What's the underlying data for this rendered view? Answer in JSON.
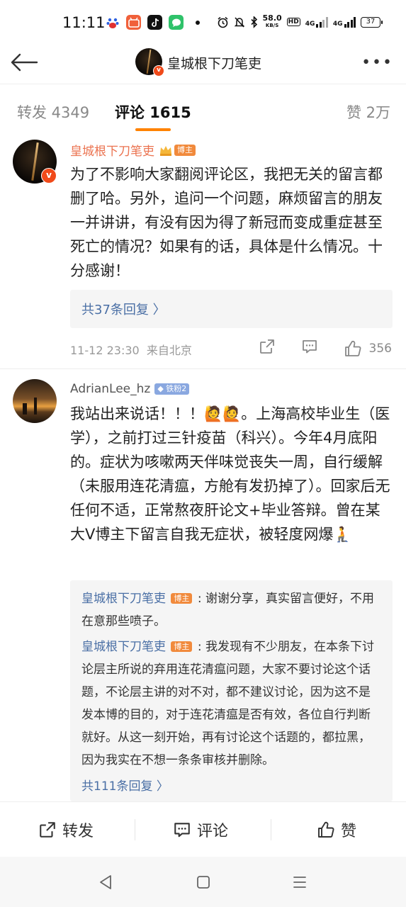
{
  "status_bar": {
    "time": "11:11",
    "net_speed": "58.0",
    "net_unit": "KB/S",
    "hd": "HD",
    "signal1": "4G",
    "signal2": "4G",
    "battery": "37"
  },
  "header": {
    "title": "皇城根下刀笔吏",
    "more": "•••"
  },
  "tabs": [
    {
      "label": "转发 4349"
    },
    {
      "label": "评论 1615"
    },
    {
      "label": "赞 2万"
    }
  ],
  "comments": [
    {
      "author": "皇城根下刀笔吏",
      "badge": "博主",
      "text": "为了不影响大家翻阅评论区，我把无关的留言都删了哈。另外，追问一个问题，麻烦留言的朋友一并讲讲，有没有因为得了新冠而变成重症甚至死亡的情况？如果有的话，具体是什么情况。十分感谢！",
      "replies_link": "共37条回复 〉",
      "time": "11-12 23:30",
      "location": "来自北京",
      "likes": "356"
    },
    {
      "author": "AdrianLee_hz",
      "badge": "铁粉2",
      "text": "我站出来说话！！！🙋🙋。上海高校毕业生（医学），之前打过三针疫苗（科兴）。今年4月底阳的。症状为咳嗽两天伴味觉丧失一周，自行缓解（未服用连花清瘟，方舱有发扔掉了）。回家后无任何不适，正常熬夜肝论文+毕业答辩。曾在某大V博主下留言自我无症状，被轻度网爆🧎",
      "replies": [
        {
          "name": "皇城根下刀笔吏",
          "badge": "博主",
          "text": ": 谢谢分享，真实留言便好，不用在意那些喷子。"
        },
        {
          "name": "皇城根下刀笔吏",
          "badge": "博主",
          "text": ": 我发现有不少朋友，在本条下讨论层主所说的弃用连花清瘟问题，大家不要讨论这个话题，不论层主讲的对不对，都不建议讨论，因为这不是发本博的目的，对于连花清瘟是否有效，各位自行判断就好。从这一刻开始，再有讨论这个话题的，都拉黑，因为我实在不想一条条审核并删除。"
        }
      ],
      "replies_link": "共111条回复 〉"
    }
  ],
  "bottom_bar": {
    "repost": "转发",
    "comment": "评论",
    "like": "赞"
  },
  "colors": {
    "accent": "#ff8200",
    "name": "#eb7350",
    "link": "#4a6fa5"
  }
}
